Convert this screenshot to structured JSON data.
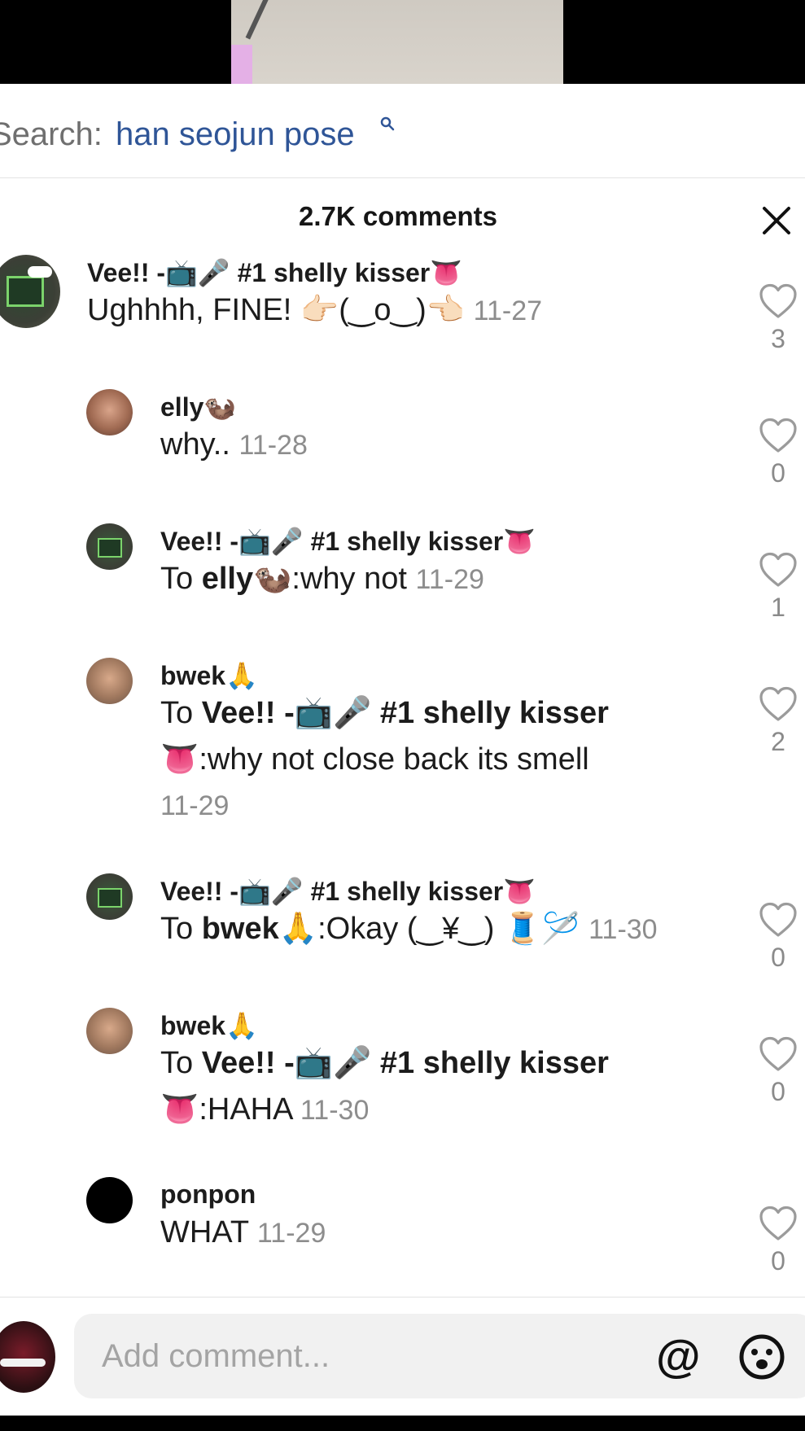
{
  "search": {
    "prefix": "Search:",
    "term": "han seojun pose"
  },
  "header": {
    "comment_count": "2.7K comments"
  },
  "comments": [
    {
      "username": "Vee!! -📺🎤 #1 shelly kisser👅",
      "text": "Ughhhh, FINE! 👉🏻(‿o‿)👈🏻",
      "date": "11-27",
      "likes": "3"
    },
    {
      "username": "elly🦦",
      "text": "why..",
      "date": "11-28",
      "likes": "0"
    },
    {
      "username": "Vee!! -📺🎤 #1 shelly kisser👅",
      "reply_to": "elly🦦",
      "text": ":why not",
      "date": "11-29",
      "likes": "1"
    },
    {
      "username": "bwek🙏",
      "reply_to": "Vee!! -📺🎤 #1 shelly kisser",
      "text_line1_suffix": "",
      "text_line2": "👅:why not close back its smell",
      "date": "11-29",
      "likes": "2"
    },
    {
      "username": "Vee!! -📺🎤 #1 shelly kisser👅",
      "reply_to": "bwek🙏",
      "text": ":Okay (‿¥‿) 🧵🪡",
      "date": "11-30",
      "likes": "0"
    },
    {
      "username": "bwek🙏",
      "reply_to": "Vee!! -📺🎤 #1 shelly kisser",
      "text_line2": "👅:HAHA",
      "date": "11-30",
      "likes": "0"
    },
    {
      "username": "ponpon",
      "text": "WHAT",
      "date": "11-29",
      "likes": "0"
    }
  ],
  "reply_prefix": "To",
  "footer": {
    "placeholder": "Add comment...",
    "at_label": "@"
  },
  "icons": {
    "search": "search-icon",
    "close": "close-icon",
    "like": "heart-icon",
    "emoji": "emoji-icon"
  }
}
